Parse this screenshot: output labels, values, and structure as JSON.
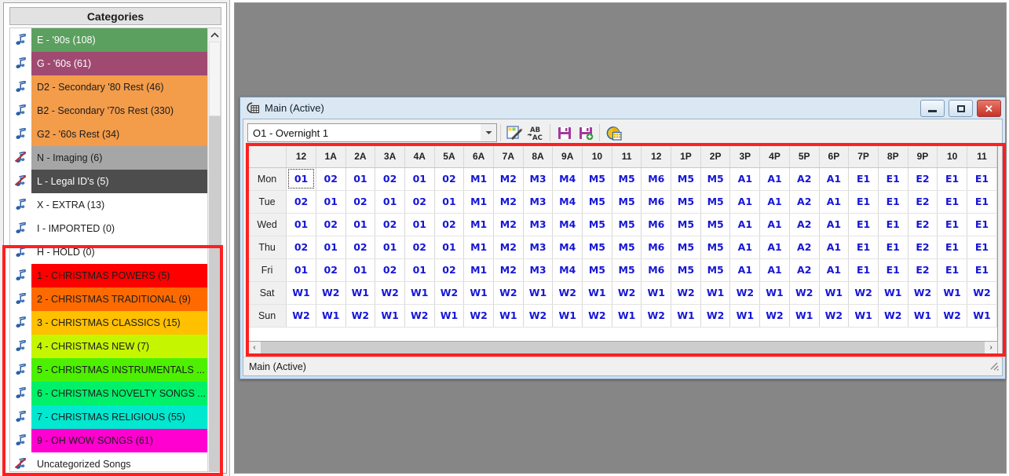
{
  "categories_panel": {
    "header": "Categories",
    "items": [
      {
        "label": "E - '90s  (108)",
        "bg": "#5ba05e",
        "fg": "#ffffff",
        "icon": "music-note-icon"
      },
      {
        "label": "G - '60s  (61)",
        "bg": "#a04a72",
        "fg": "#ffffff",
        "icon": "music-note-icon"
      },
      {
        "label": "D2 - Secondary '80 Rest  (46)",
        "bg": "#f39c4a",
        "fg": "#1c1c1c",
        "icon": "music-note-icon"
      },
      {
        "label": "B2 - Secondary '70s Rest  (330)",
        "bg": "#f39c4a",
        "fg": "#1c1c1c",
        "icon": "music-note-icon"
      },
      {
        "label": "G2 - '60s Rest  (34)",
        "bg": "#f39c4a",
        "fg": "#1c1c1c",
        "icon": "music-note-icon"
      },
      {
        "label": "N - Imaging  (6)",
        "bg": "#a6a6a6",
        "fg": "#1c1c1c",
        "icon": "music-note-muted-icon"
      },
      {
        "label": "L - Legal ID's  (5)",
        "bg": "#4d4d4d",
        "fg": "#ffffff",
        "icon": "music-note-muted-icon"
      },
      {
        "label": "X - EXTRA  (13)",
        "bg": "#ffffff",
        "fg": "#1c1c1c",
        "icon": "music-note-icon"
      },
      {
        "label": "I - IMPORTED  (0)",
        "bg": "#ffffff",
        "fg": "#1c1c1c",
        "icon": "music-note-icon"
      },
      {
        "label": "H - HOLD  (0)",
        "bg": "#ffffff",
        "fg": "#1c1c1c",
        "icon": "music-note-icon"
      },
      {
        "label": "1 - CHRISTMAS POWERS  (5)",
        "bg": "#fe0000",
        "fg": "#1c1c1c",
        "icon": "music-note-icon"
      },
      {
        "label": "2 - CHRISTMAS TRADITIONAL  (9)",
        "bg": "#fe6a00",
        "fg": "#1c1c1c",
        "icon": "music-note-icon"
      },
      {
        "label": "3 - CHRISTMAS CLASSICS  (15)",
        "bg": "#ffc000",
        "fg": "#1c1c1c",
        "icon": "music-note-icon"
      },
      {
        "label": "4 - CHRISTMAS NEW  (7)",
        "bg": "#c6f500",
        "fg": "#1c1c1c",
        "icon": "music-note-icon"
      },
      {
        "label": "5 - CHRISTMAS INSTRUMENTALS ...",
        "bg": "#4cf000",
        "fg": "#1c1c1c",
        "icon": "music-note-icon"
      },
      {
        "label": "6 - CHRISTMAS NOVELTY SONGS ...",
        "bg": "#00f06a",
        "fg": "#1c1c1c",
        "icon": "music-note-icon"
      },
      {
        "label": "7 - CHRISTMAS RELIGIOUS  (55)",
        "bg": "#00e8d0",
        "fg": "#1c1c1c",
        "icon": "music-note-icon"
      },
      {
        "label": "9 - OH WOW SONGS  (61)",
        "bg": "#ff00d0",
        "fg": "#1c1c1c",
        "icon": "music-note-icon"
      },
      {
        "label": "Uncategorized Songs",
        "bg": "#ffffff",
        "fg": "#1c1c1c",
        "icon": "music-note-muted-icon"
      }
    ]
  },
  "window": {
    "title": "Main (Active)",
    "icon": "clock-grid-icon",
    "buttons": {
      "minimize": "–",
      "maximize": "□",
      "close": "✕"
    },
    "status": "Main (Active)"
  },
  "toolbar": {
    "combo_value": "O1 - Overnight 1",
    "combo_arrow": "▾",
    "buttons": [
      {
        "name": "edit-clock-button",
        "icon": "pencil-notepad-icon"
      },
      {
        "name": "replace-button",
        "icon": "ab-to-ac-icon"
      },
      {
        "name": "save-button",
        "icon": "floppy-save-icon"
      },
      {
        "name": "save-as-button",
        "icon": "floppy-save-add-icon"
      },
      {
        "name": "clock-calendar-button",
        "icon": "clock-calendar-icon"
      }
    ]
  },
  "grid": {
    "corner_label": "",
    "hours": [
      "12",
      "1A",
      "2A",
      "3A",
      "4A",
      "5A",
      "6A",
      "7A",
      "8A",
      "9A",
      "10",
      "11",
      "12",
      "1P",
      "2P",
      "3P",
      "4P",
      "5P",
      "6P",
      "7P",
      "8P",
      "9P",
      "10",
      "11"
    ],
    "rows": [
      {
        "day": "Mon",
        "slots": [
          "01",
          "02",
          "01",
          "02",
          "01",
          "02",
          "M1",
          "M2",
          "M3",
          "M4",
          "M5",
          "M5",
          "M6",
          "M5",
          "M5",
          "A1",
          "A1",
          "A2",
          "A1",
          "E1",
          "E1",
          "E2",
          "E1",
          "E1"
        ]
      },
      {
        "day": "Tue",
        "slots": [
          "02",
          "01",
          "02",
          "01",
          "02",
          "01",
          "M1",
          "M2",
          "M3",
          "M4",
          "M5",
          "M5",
          "M6",
          "M5",
          "M5",
          "A1",
          "A1",
          "A2",
          "A1",
          "E1",
          "E1",
          "E2",
          "E1",
          "E1"
        ]
      },
      {
        "day": "Wed",
        "slots": [
          "01",
          "02",
          "01",
          "02",
          "01",
          "02",
          "M1",
          "M2",
          "M3",
          "M4",
          "M5",
          "M5",
          "M6",
          "M5",
          "M5",
          "A1",
          "A1",
          "A2",
          "A1",
          "E1",
          "E1",
          "E2",
          "E1",
          "E1"
        ]
      },
      {
        "day": "Thu",
        "slots": [
          "02",
          "01",
          "02",
          "01",
          "02",
          "01",
          "M1",
          "M2",
          "M3",
          "M4",
          "M5",
          "M5",
          "M6",
          "M5",
          "M5",
          "A1",
          "A1",
          "A2",
          "A1",
          "E1",
          "E1",
          "E2",
          "E1",
          "E1"
        ]
      },
      {
        "day": "Fri",
        "slots": [
          "01",
          "02",
          "01",
          "02",
          "01",
          "02",
          "M1",
          "M2",
          "M3",
          "M4",
          "M5",
          "M5",
          "M6",
          "M5",
          "M5",
          "A1",
          "A1",
          "A2",
          "A1",
          "E1",
          "E1",
          "E2",
          "E1",
          "E1"
        ]
      },
      {
        "day": "Sat",
        "slots": [
          "W1",
          "W2",
          "W1",
          "W2",
          "W1",
          "W2",
          "W1",
          "W2",
          "W1",
          "W2",
          "W1",
          "W2",
          "W1",
          "W2",
          "W1",
          "W2",
          "W1",
          "W2",
          "W1",
          "W2",
          "W1",
          "W2",
          "W1",
          "W2"
        ]
      },
      {
        "day": "Sun",
        "slots": [
          "W2",
          "W1",
          "W2",
          "W1",
          "W2",
          "W1",
          "W2",
          "W1",
          "W2",
          "W1",
          "W2",
          "W1",
          "W2",
          "W1",
          "W2",
          "W1",
          "W2",
          "W1",
          "W2",
          "W1",
          "W2",
          "W1",
          "W2",
          "W1"
        ]
      }
    ],
    "selected": {
      "row": 0,
      "col": 0
    }
  },
  "scrollbars": {
    "h_left_arrow": "‹",
    "h_right_arrow": "›",
    "v_up_arrow": "^"
  },
  "colors": {
    "highlight_box": "#ff1f1f",
    "slot_text": "#1616d6",
    "window_border": "#6f93b5"
  }
}
